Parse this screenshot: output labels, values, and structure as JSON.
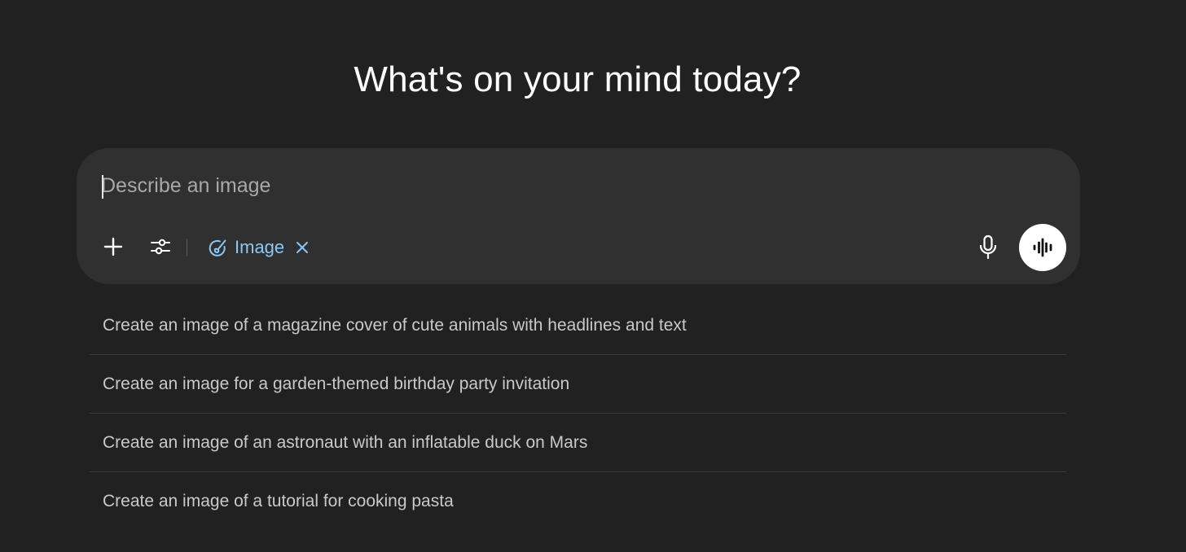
{
  "heading": "What's on your mind today?",
  "composer": {
    "placeholder": "Describe an image",
    "value": "",
    "attach_icon": "plus-icon",
    "tools_icon": "sliders-icon",
    "mode_pill": {
      "label": "Image",
      "icon": "image-palette-icon",
      "close_icon": "close-icon"
    },
    "mic_icon": "microphone-icon",
    "voice_icon": "voice-waveform-icon"
  },
  "suggestions": [
    "Create an image of a magazine cover of cute animals with headlines and text",
    "Create an image for a garden-themed birthday party invitation",
    "Create an image of an astronaut with an inflatable duck on Mars",
    "Create an image of a tutorial for cooking pasta"
  ],
  "colors": {
    "background": "#212121",
    "composer": "#303030",
    "accent": "#8cc7f5",
    "voice_button": "#ffffff"
  }
}
